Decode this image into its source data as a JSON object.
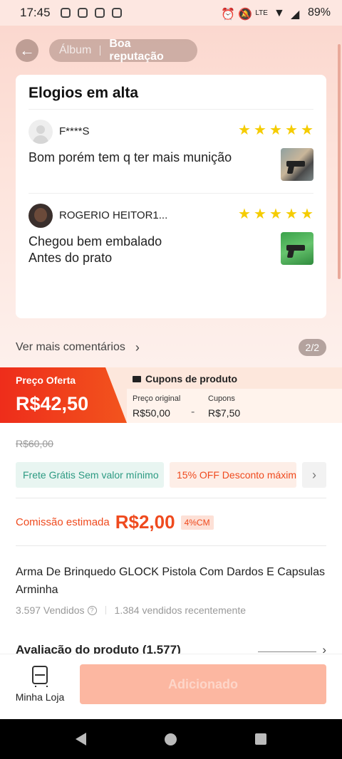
{
  "status_bar": {
    "time": "17:45",
    "battery": "89%",
    "network": "LTE"
  },
  "header": {
    "tab_album": "Álbum",
    "tab_reputation": "Boa reputação"
  },
  "reviews_card": {
    "title": "Elogios em alta",
    "reviews": [
      {
        "username": "F****S",
        "text": "Bom porém tem q ter mais munição",
        "stars": 5
      },
      {
        "username": "ROGERIO HEITOR1...",
        "text": "Chegou bem embalado\nAntes do prato",
        "stars": 5
      }
    ]
  },
  "more_comments": {
    "label": "Ver mais comentários",
    "page_indicator": "2/2"
  },
  "price_banner": {
    "offer_label": "Preço Oferta",
    "offer_price": "R$42,50",
    "coupons_title": "Cupons de produto",
    "original_label": "Preço original",
    "original_value": "R$50,00",
    "coupons_label": "Cupons",
    "coupons_value": "R$7,50",
    "minus": "-"
  },
  "product": {
    "old_price": "R$60,00",
    "promo_chips": [
      "Frete Grátis Sem valor mínimo",
      "15% OFF Desconto máximo"
    ],
    "commission_label": "Comissão estimada",
    "commission_value": "R$2,00",
    "commission_tag": "4%CM",
    "title": "Arma De Brinquedo GLOCK Pistola Com Dardos E Capsulas Arminha",
    "sold_total": "3.597 Vendidos",
    "sold_recent": "1.384 vendidos recentemente",
    "rating_label": "Avaliação do produto (1.577)"
  },
  "bottom_bar": {
    "shop_label": "Minha Loja",
    "add_label": "Adicionado"
  },
  "colors": {
    "accent": "#ee2d1b",
    "star": "#f5cc00",
    "green_chip": "#2c9a82"
  }
}
